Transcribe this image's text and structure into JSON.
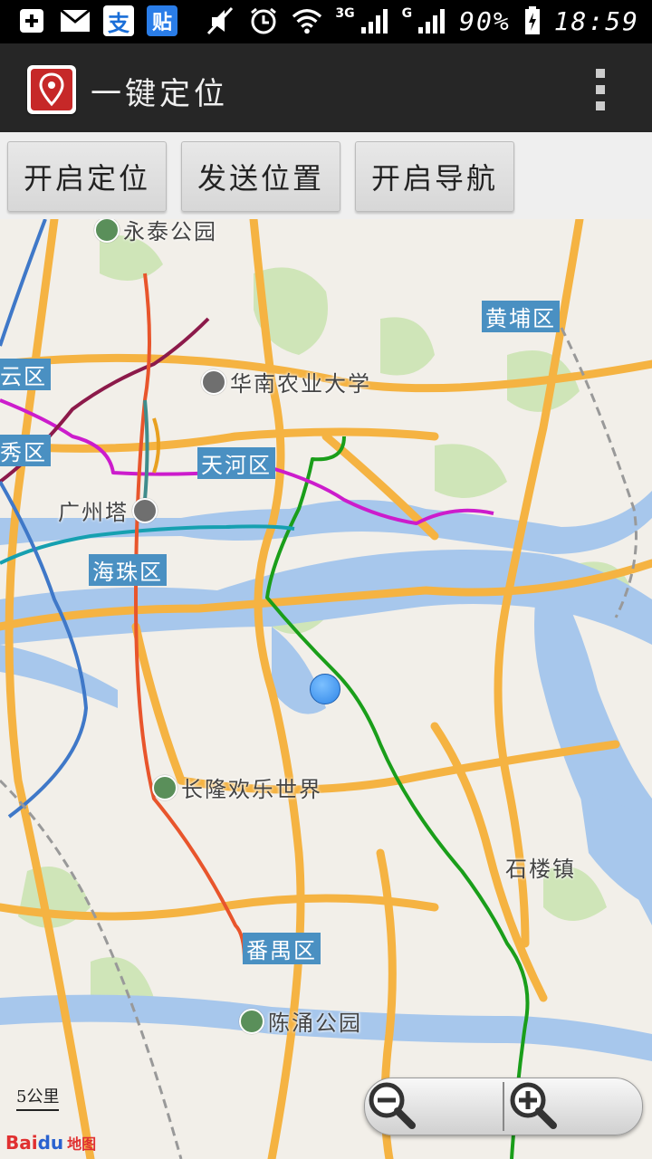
{
  "status_bar": {
    "network_3g": "3G",
    "network_g": "G",
    "battery": "90%",
    "time": "18:59",
    "notification_icons": [
      "add-icon",
      "mail-icon",
      "alipay-icon",
      "tieba-icon"
    ],
    "system_icons": [
      "mute-icon",
      "alarm-icon",
      "wifi-icon",
      "signal-icon",
      "signal-icon",
      "battery-charging-icon"
    ],
    "tieba_label": "贴",
    "alipay_label": "支"
  },
  "app_bar": {
    "title": "一键定位",
    "icon": "location-pin-icon",
    "menu_icon": "overflow-menu-icon"
  },
  "toolbar": {
    "buttons": [
      {
        "label": "开启定位"
      },
      {
        "label": "发送位置"
      },
      {
        "label": "开启导航"
      }
    ]
  },
  "map": {
    "district_labels": [
      "黄埔区",
      "白云区",
      "越秀区",
      "天河区",
      "海珠区",
      "番禺区"
    ],
    "place_labels": {
      "yongtai": "永泰公园",
      "scau": "华南农业大学",
      "canton_tower": "广州塔",
      "chimelong": "长隆欢乐世界",
      "chenyong": "陈涌公园",
      "shilou": "石楼镇"
    },
    "scale_label": "5公里",
    "logo": {
      "bai": "Bai",
      "du": "du",
      "ditu": "地图"
    },
    "zoom_out_icon": "zoom-out-icon",
    "zoom_in_icon": "zoom-in-icon",
    "colors": {
      "water": "#a7c7ec",
      "highway": "#f5b342",
      "land": "#f2efe9",
      "park": "#cfe5b8",
      "metro_green": "#1a9e1a",
      "metro_magenta": "#cc1ccc",
      "metro_teal": "#16a0b0",
      "metro_red": "#e8552c",
      "metro_blue": "#3f78c8",
      "metro_maroon": "#8c1a4a",
      "label_bg": "#4a90c2"
    }
  }
}
